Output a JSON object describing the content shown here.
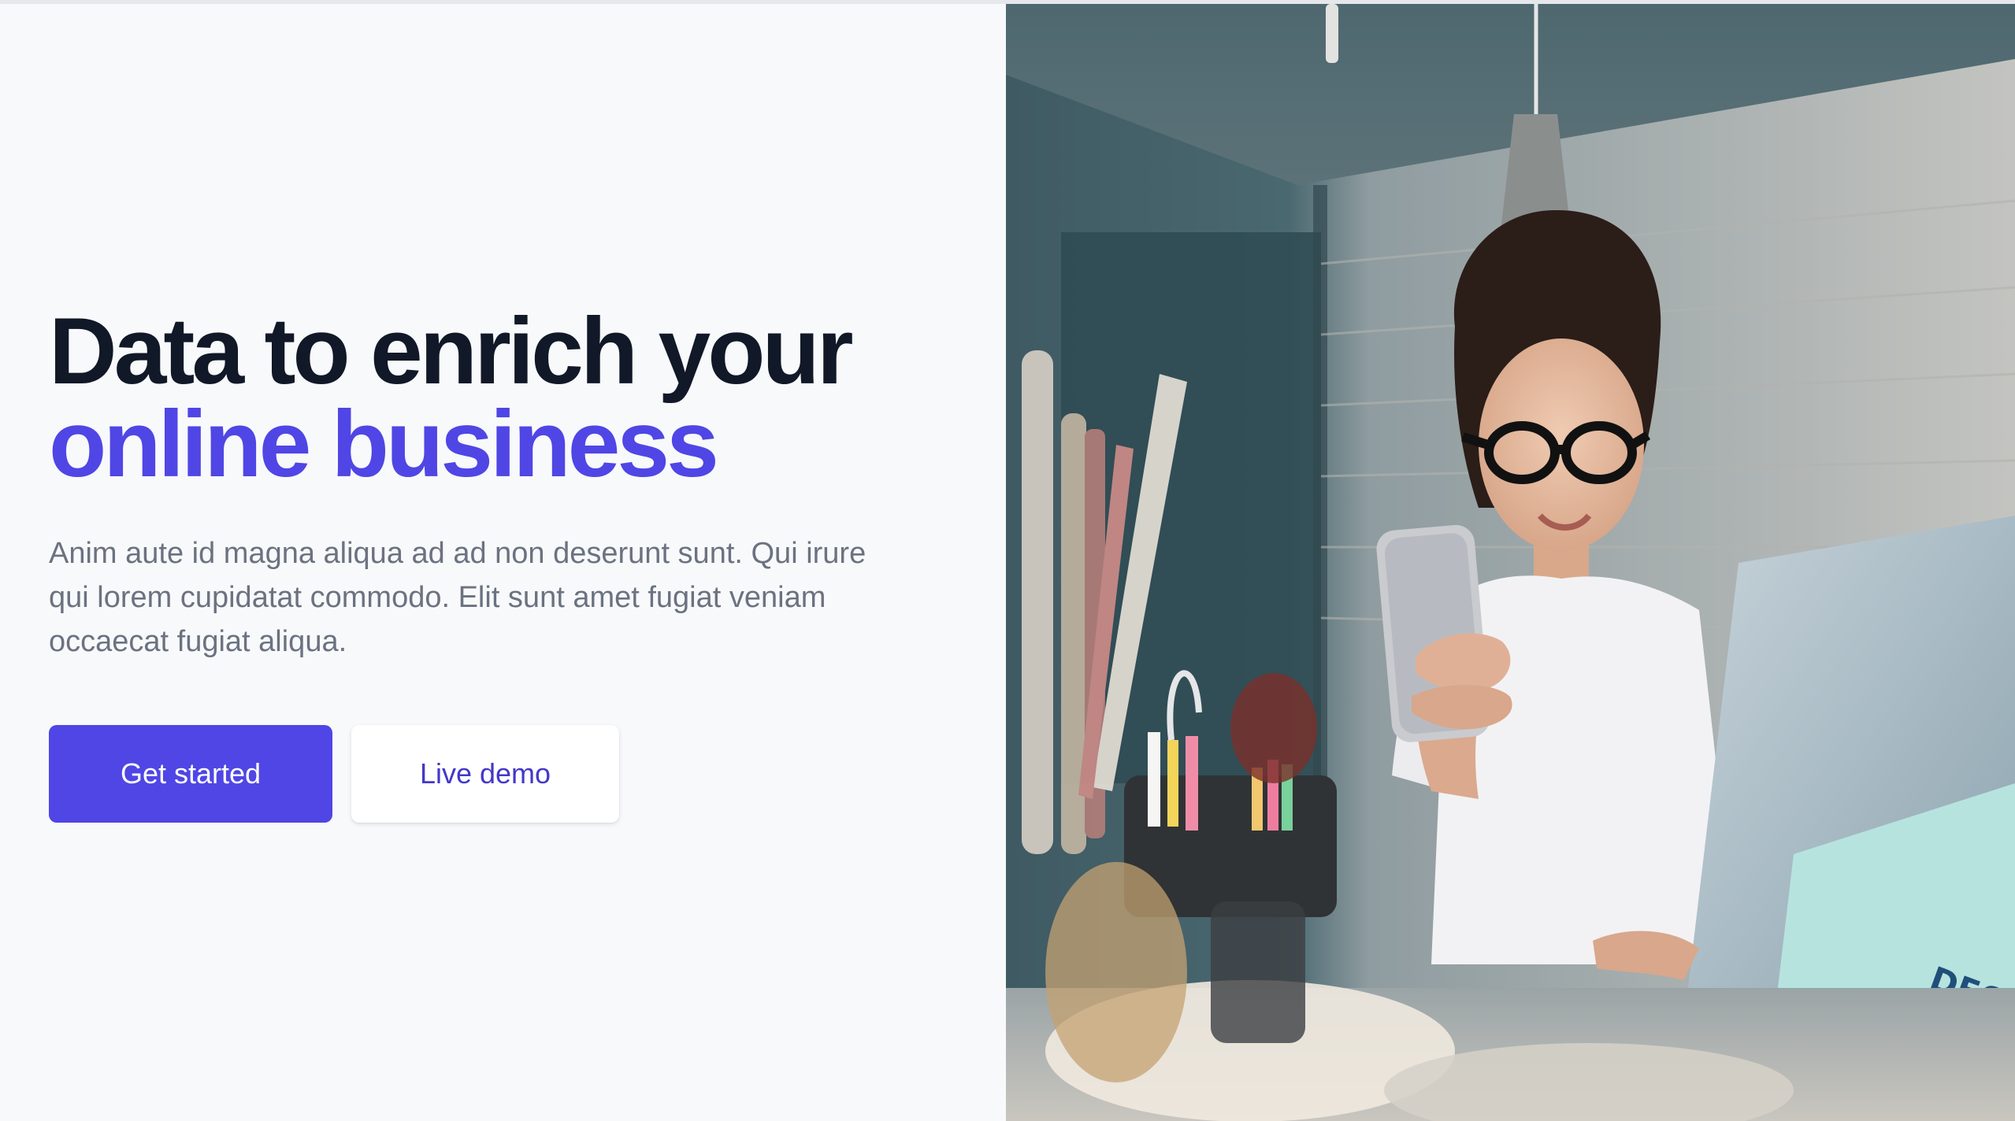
{
  "hero": {
    "headline_line1": "Data to enrich your",
    "headline_line2": "online business",
    "description": "Anim aute id magna aliqua ad ad non deserunt sunt. Qui irure qui lorem cupidatat commodo. Elit sunt amet fugiat veniam occaecat fugiat aliqua."
  },
  "actions": {
    "primary_label": "Get started",
    "secondary_label": "Live demo"
  },
  "colors": {
    "accent": "#4f46e5",
    "heading": "#111827",
    "body_text": "#6b7280",
    "panel_background": "#f8f9fb"
  },
  "image": {
    "icon": "hero-photo-woman-with-phone-and-laptop"
  }
}
